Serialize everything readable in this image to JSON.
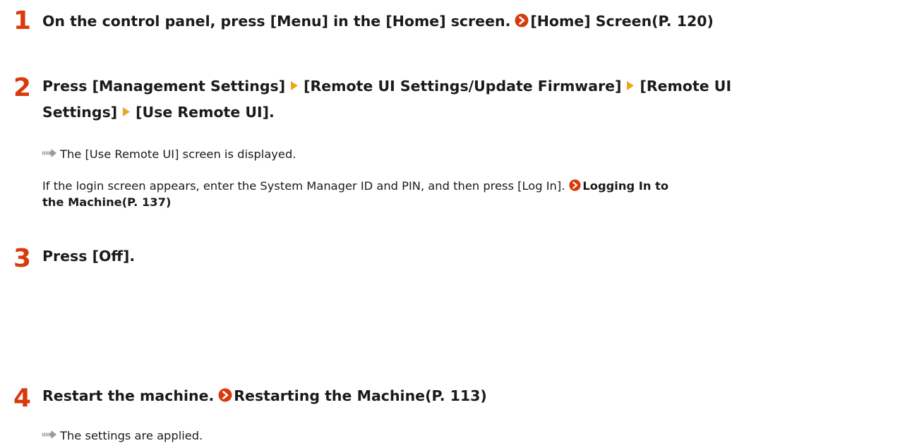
{
  "steps": [
    {
      "number": "1",
      "text": "On the control panel, press [Menu] in the [Home] screen.",
      "link": "[Home] Screen(P. 120)"
    },
    {
      "number": "2",
      "items": [
        "Press [Management Settings]",
        "[Remote UI Settings/Update Firmware]",
        "[Remote UI",
        "Settings]",
        "[Use Remote UI]."
      ],
      "result": "The [Use Remote UI] screen is displayed.",
      "note": "If the login screen appears, enter the System Manager ID and PIN, and then press [Log In].",
      "note_link_line1": "Logging In to",
      "note_link_line2": "the Machine(P. 137)"
    },
    {
      "number": "3",
      "text": "Press [Off]."
    },
    {
      "number": "4",
      "text": "Restart the machine.",
      "link": "Restarting the Machine(P. 113)",
      "result": "The settings are applied."
    }
  ],
  "colors": {
    "step_number": "#d93a0b",
    "link_icon": "#d93a0b",
    "arrow": "#f0a323",
    "result_marker": "#9a9a9a"
  },
  "icons": {
    "link": "circle-arrow-icon",
    "separator": "triangle-right-icon",
    "result": "result-arrow-icon"
  }
}
